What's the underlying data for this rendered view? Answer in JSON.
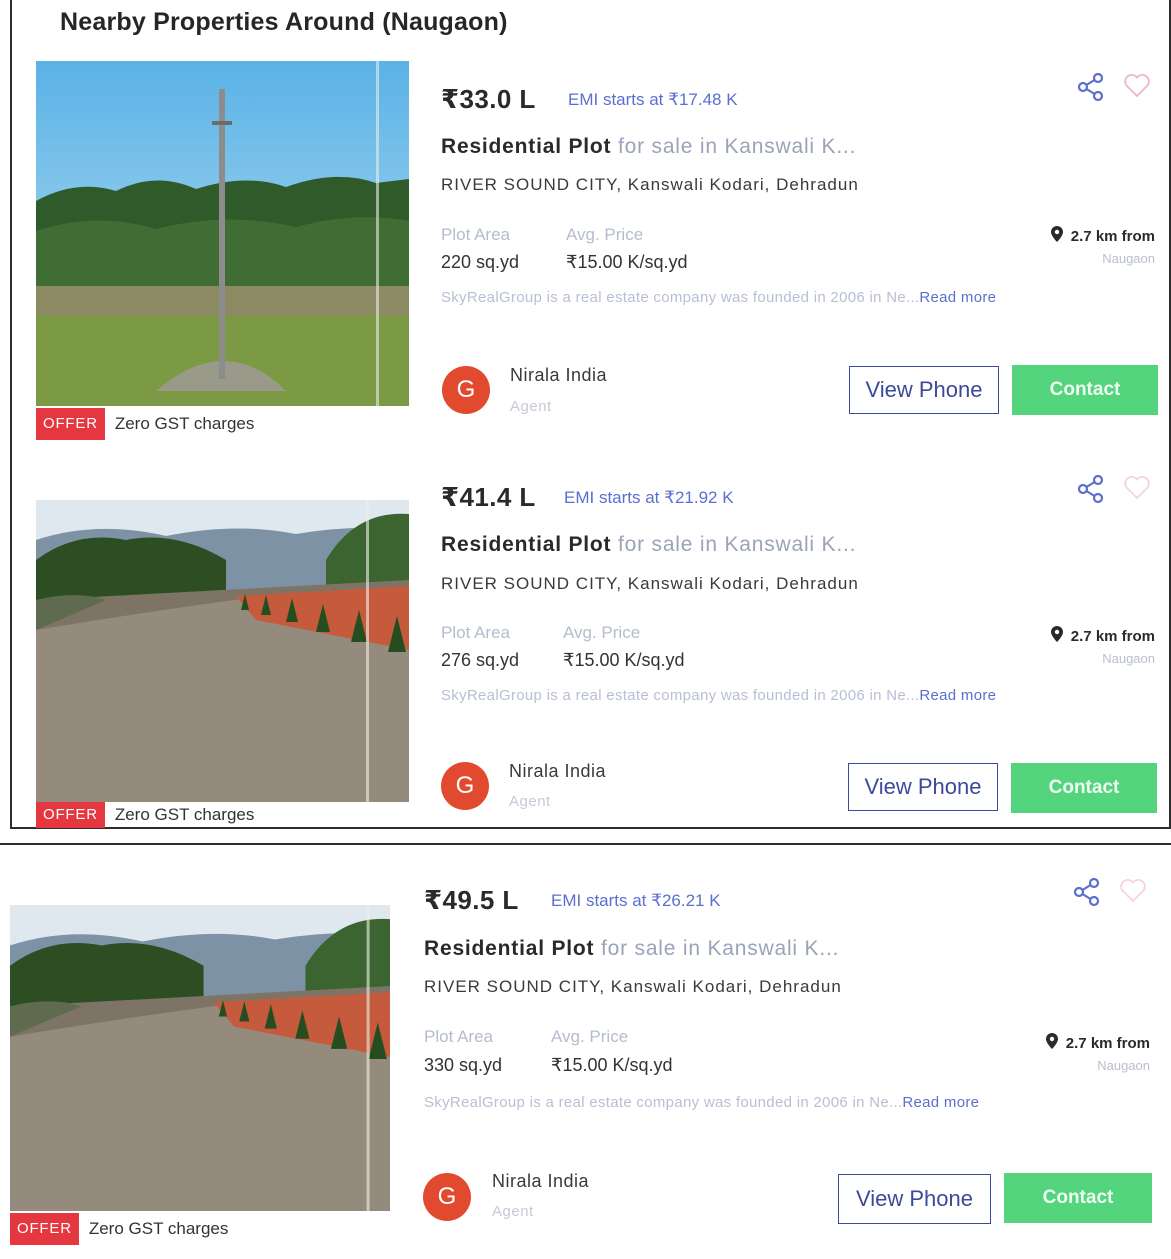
{
  "section_title": "Nearby Properties Around (Naugaon)",
  "labels": {
    "plot_area": "Plot Area",
    "avg_price": "Avg. Price",
    "read_more": "Read more",
    "view_phone": "View Phone",
    "contact": "Contact",
    "offer_tag": "OFFER"
  },
  "colors": {
    "offer_red": "#e5373f",
    "contact_green": "#55d47e",
    "link_blue": "#5b6fd0",
    "avatar_red": "#e14a2f"
  },
  "listings": [
    {
      "price": "₹33.0 L",
      "emi": "EMI starts at ₹17.48 K",
      "title_bold": "Residential Plot",
      "title_rest": " for sale in Kanswali K...",
      "address": "RIVER SOUND CITY, Kanswali Kodari, Dehradun",
      "plot_area": "220 sq.yd",
      "avg_price": "₹15.00 K/sq.yd",
      "distance": "2.7 km from",
      "distance_place": "Naugaon",
      "description": "SkyRealGroup is a real estate company was founded in 2006 in Ne...",
      "agent_initial": "G",
      "agent_name": "Nirala India",
      "agent_role": "Agent",
      "offer_text": "Zero GST charges"
    },
    {
      "price": "₹41.4 L",
      "emi": "EMI starts at ₹21.92 K",
      "title_bold": "Residential Plot",
      "title_rest": " for sale in Kanswali K...",
      "address": "RIVER SOUND CITY, Kanswali Kodari, Dehradun",
      "plot_area": "276 sq.yd",
      "avg_price": "₹15.00 K/sq.yd",
      "distance": "2.7 km from",
      "distance_place": "Naugaon",
      "description": "SkyRealGroup is a real estate company was founded in 2006 in Ne...",
      "agent_initial": "G",
      "agent_name": "Nirala India",
      "agent_role": "Agent",
      "offer_text": "Zero GST charges"
    },
    {
      "price": "₹49.5 L",
      "emi": "EMI starts at ₹26.21 K",
      "title_bold": "Residential Plot",
      "title_rest": " for sale in Kanswali K...",
      "address": "RIVER SOUND CITY, Kanswali Kodari, Dehradun",
      "plot_area": "330 sq.yd",
      "avg_price": "₹15.00 K/sq.yd",
      "distance": "2.7 km from",
      "distance_place": "Naugaon",
      "description": "SkyRealGroup is a real estate company was founded in 2006 in Ne...",
      "agent_initial": "G",
      "agent_name": "Nirala India",
      "agent_role": "Agent",
      "offer_text": "Zero GST charges"
    }
  ],
  "icons": {
    "share": "share-icon",
    "wishlist": "heart-icon",
    "location": "location-pin-icon"
  }
}
